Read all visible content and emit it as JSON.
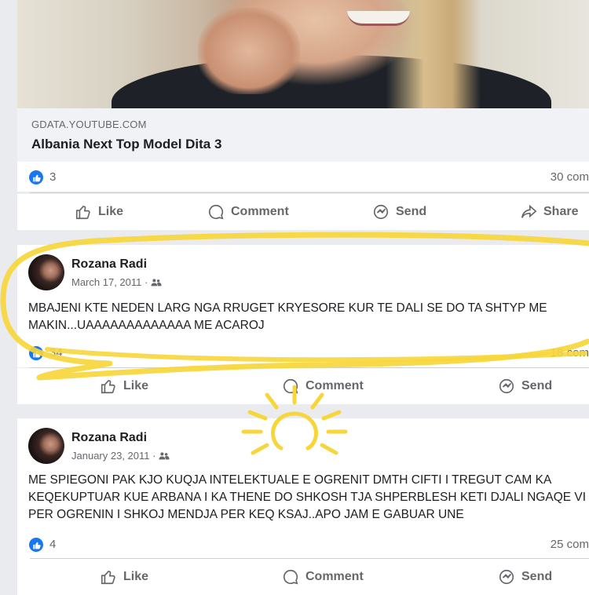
{
  "link_preview": {
    "domain": "GDATA.YOUTUBE.COM",
    "title": "Albania Next Top Model Dita 3",
    "likes": "3",
    "comments": "30 com"
  },
  "actions": {
    "like": "Like",
    "comment": "Comment",
    "send": "Send",
    "share": "Share"
  },
  "posts": [
    {
      "author": "Rozana Radi",
      "date": "March 17, 2011 ·",
      "text": "MBAJENI KTE NEDEN LARG NGA RRUGET KRYESORE KUR TE DALI SE DO TA SHTYP ME\nMAKIN...UAAAAAAAAAAAAA ME ACAROJ",
      "likes": "34",
      "comments": "18 com"
    },
    {
      "author": "Rozana Radi",
      "date": "January 23, 2011 ·",
      "text": "ME SPIEGONI PAK KJO KUQJA INTELEKTUALE E OGRENIT DMTH CIFTI I TREGUT CAM KA\nKEQEKUPTUAR KUE ARBANA I KA THENE DO SHKOSH TJA SHPERBLESH KETI DJALI NGAQE VI\nPER OGRENIN I SHKOJ MENDJA PER KEQ KSAJ..APO JAM E GABUAR UNE",
      "likes": "4",
      "comments": "25 com"
    }
  ],
  "colors": {
    "like_blue": "#1877f2",
    "highlight_yellow": "#f6d63a",
    "muted_text": "#65676b"
  },
  "icons": [
    "like-icon",
    "comment-icon",
    "send-icon",
    "share-icon",
    "audience-friends-icon",
    "sun-icon"
  ]
}
